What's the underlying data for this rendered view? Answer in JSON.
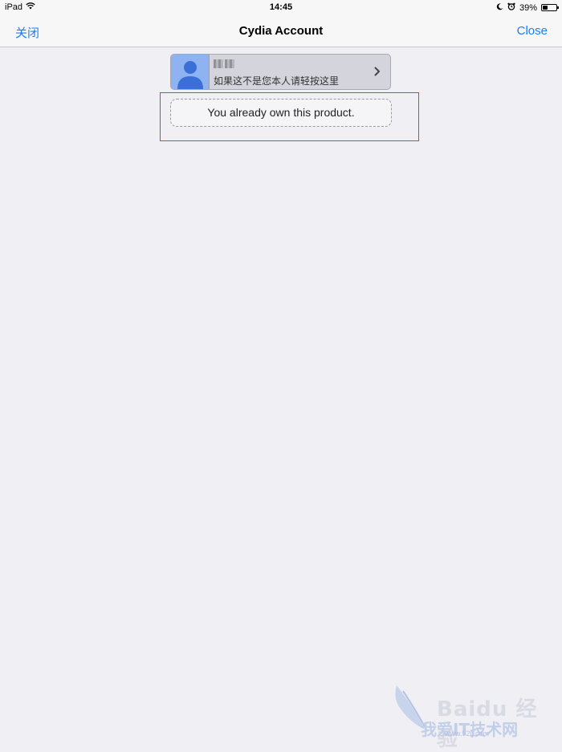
{
  "status_bar": {
    "device": "iPad",
    "time": "14:45",
    "battery_percent": "39%",
    "battery_level": 0.39
  },
  "nav": {
    "left_label": "关闭",
    "title": "Cydia Account",
    "right_label": "Close"
  },
  "account_card": {
    "hint": "如果这不是您本人请轻按这里"
  },
  "message": {
    "text": "You already own this product."
  },
  "watermark": {
    "line1": "Baidu 经验",
    "line2": "我爱IT技术网",
    "line3": "www.52ij.com"
  },
  "colors": {
    "accent": "#1e7cf2",
    "background": "#efeff4",
    "highlight_border": "#e23a3a"
  }
}
